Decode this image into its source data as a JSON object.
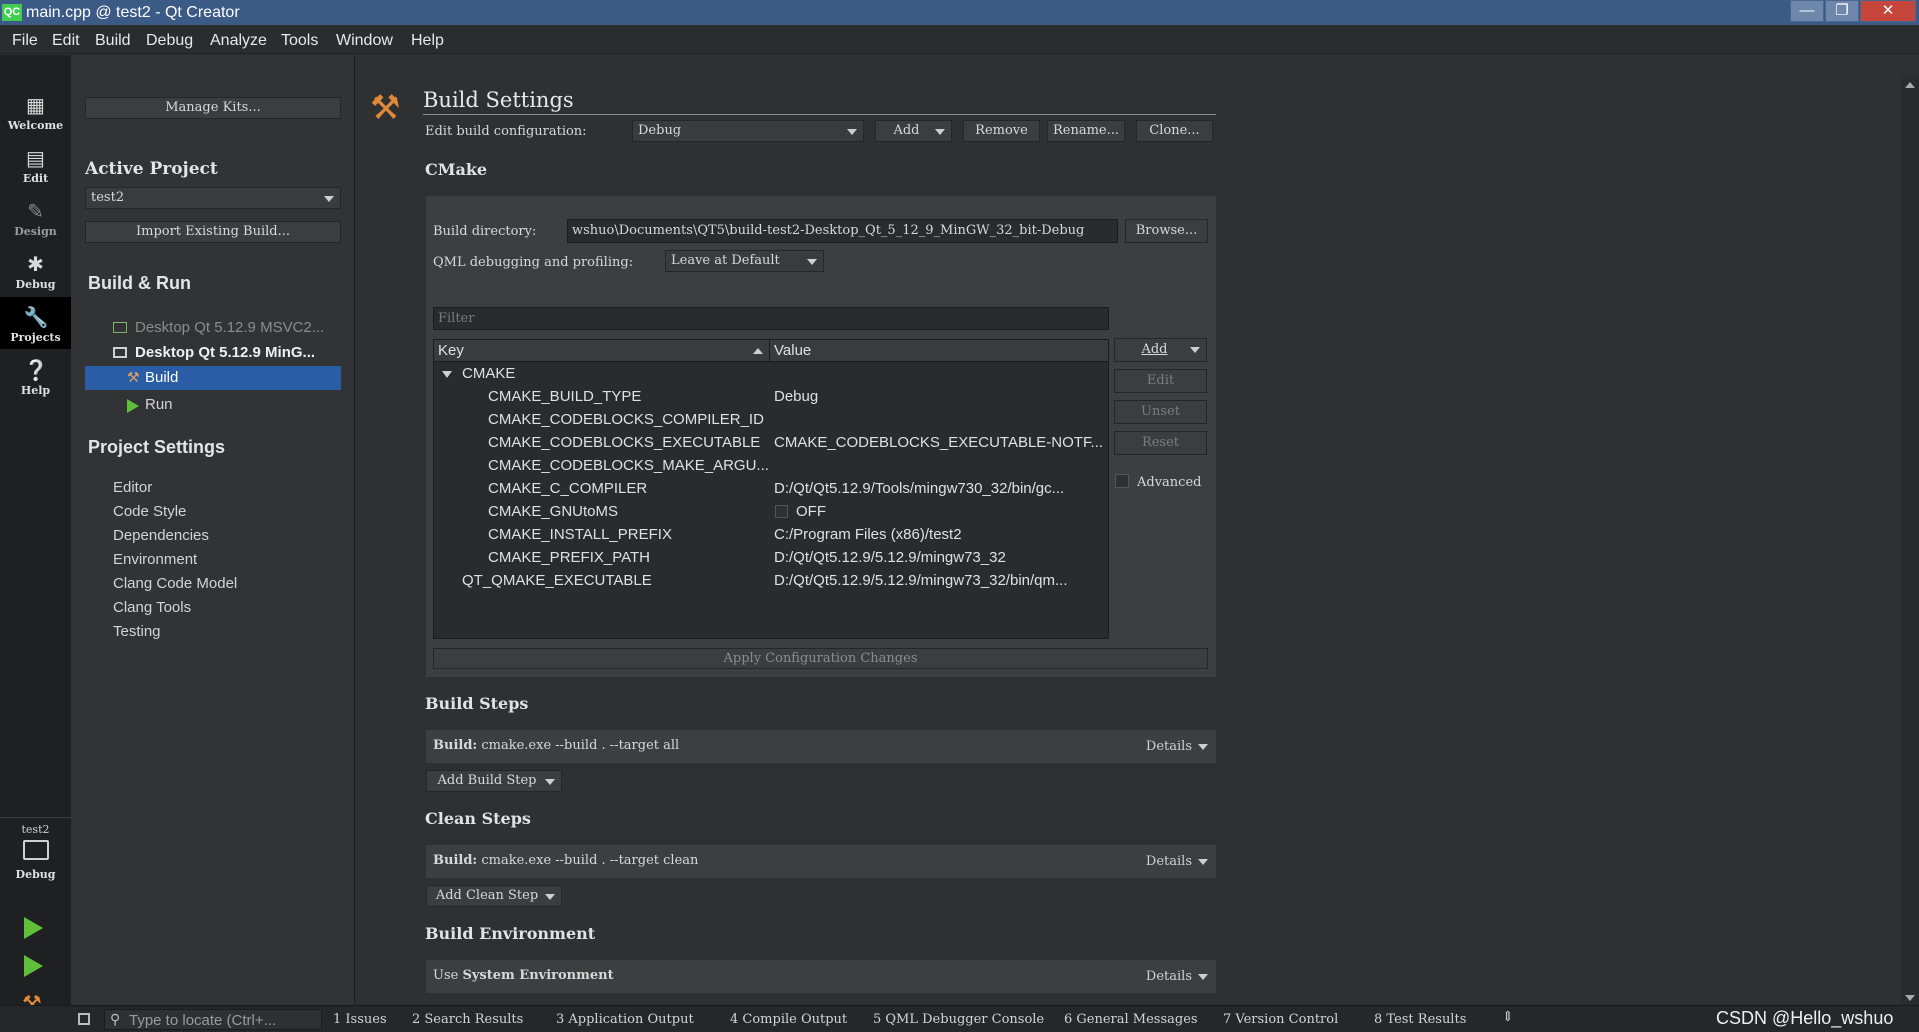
{
  "window": {
    "title": "main.cpp @ test2 - Qt Creator",
    "app_badge": "QC"
  },
  "menu": [
    "File",
    "Edit",
    "Build",
    "Debug",
    "Analyze",
    "Tools",
    "Window",
    "Help"
  ],
  "modes": [
    {
      "label": "Welcome",
      "icon": "grid-icon"
    },
    {
      "label": "Edit",
      "icon": "edit-doc-icon"
    },
    {
      "label": "Design",
      "icon": "pen-icon"
    },
    {
      "label": "Debug",
      "icon": "bug-icon"
    },
    {
      "label": "Projects",
      "icon": "wrench-icon"
    },
    {
      "label": "Help",
      "icon": "help-icon"
    }
  ],
  "kit_selector": {
    "project": "test2",
    "mode": "Debug"
  },
  "left": {
    "manage_kits": "Manage Kits...",
    "active_project_heading": "Active Project",
    "active_project": "test2",
    "import_build": "Import Existing Build...",
    "build_run_heading": "Build & Run",
    "kits": [
      {
        "label": "Desktop Qt 5.12.9 MSVC2...",
        "bold": false
      },
      {
        "label": "Desktop Qt 5.12.9 MinG...",
        "bold": true
      }
    ],
    "build_item": "Build",
    "run_item": "Run",
    "project_settings_heading": "Project Settings",
    "settings": [
      "Editor",
      "Code Style",
      "Dependencies",
      "Environment",
      "Clang Code Model",
      "Clang Tools",
      "Testing"
    ]
  },
  "main": {
    "title": "Build Settings",
    "edit_config_label": "Edit build configuration:",
    "config_value": "Debug",
    "add": "Add",
    "remove": "Remove",
    "rename": "Rename...",
    "clone": "Clone...",
    "cmake_heading": "CMake",
    "build_dir_label": "Build directory:",
    "build_dir_value": "wshuo\\Documents\\QT5\\build-test2-Desktop_Qt_5_12_9_MinGW_32_bit-Debug",
    "browse": "Browse...",
    "qml_label": "QML debugging and profiling:",
    "qml_value": "Leave at Default",
    "filter_placeholder": "Filter",
    "col_key": "Key",
    "col_value": "Value",
    "group": "CMAKE",
    "rows": [
      {
        "key": "CMAKE_BUILD_TYPE",
        "value": "Debug"
      },
      {
        "key": "CMAKE_CODEBLOCKS_COMPILER_ID",
        "value": ""
      },
      {
        "key": "CMAKE_CODEBLOCKS_EXECUTABLE",
        "value": "CMAKE_CODEBLOCKS_EXECUTABLE-NOTF..."
      },
      {
        "key": "CMAKE_CODEBLOCKS_MAKE_ARGU...",
        "value": ""
      },
      {
        "key": "CMAKE_C_COMPILER",
        "value": "D:/Qt/Qt5.12.9/Tools/mingw730_32/bin/gc..."
      },
      {
        "key": "CMAKE_GNUtoMS",
        "value": "OFF"
      },
      {
        "key": "CMAKE_INSTALL_PREFIX",
        "value": "C:/Program Files (x86)/test2"
      },
      {
        "key": "CMAKE_PREFIX_PATH",
        "value": "D:/Qt/Qt5.12.9/5.12.9/mingw73_32"
      }
    ],
    "top_row": {
      "key": "QT_QMAKE_EXECUTABLE",
      "value": "D:/Qt/Qt5.12.9/5.12.9/mingw73_32/bin/qm..."
    },
    "side_add": "Add",
    "side_edit": "Edit",
    "side_unset": "Unset",
    "side_reset": "Reset",
    "advanced": "Advanced",
    "apply": "Apply Configuration Changes",
    "build_steps_heading": "Build Steps",
    "build_step_prefix": "Build:",
    "build_step_cmd": "cmake.exe --build . --target all",
    "details": "Details",
    "add_build_step": "Add Build Step",
    "clean_steps_heading": "Clean Steps",
    "clean_step_prefix": "Build:",
    "clean_step_cmd": "cmake.exe --build . --target clean",
    "add_clean_step": "Add Clean Step",
    "build_env_heading": "Build Environment",
    "env_use": "Use",
    "env_value": "System Environment"
  },
  "status": {
    "locator_placeholder": "Type to locate (Ctrl+...",
    "panes": [
      "1 Issues",
      "2 Search Results",
      "3 Application Output",
      "4 Compile Output",
      "5 QML Debugger Console",
      "6 General Messages",
      "7 Version Control",
      "8 Test Results"
    ],
    "watermark": "CSDN @Hello_wshuo"
  }
}
